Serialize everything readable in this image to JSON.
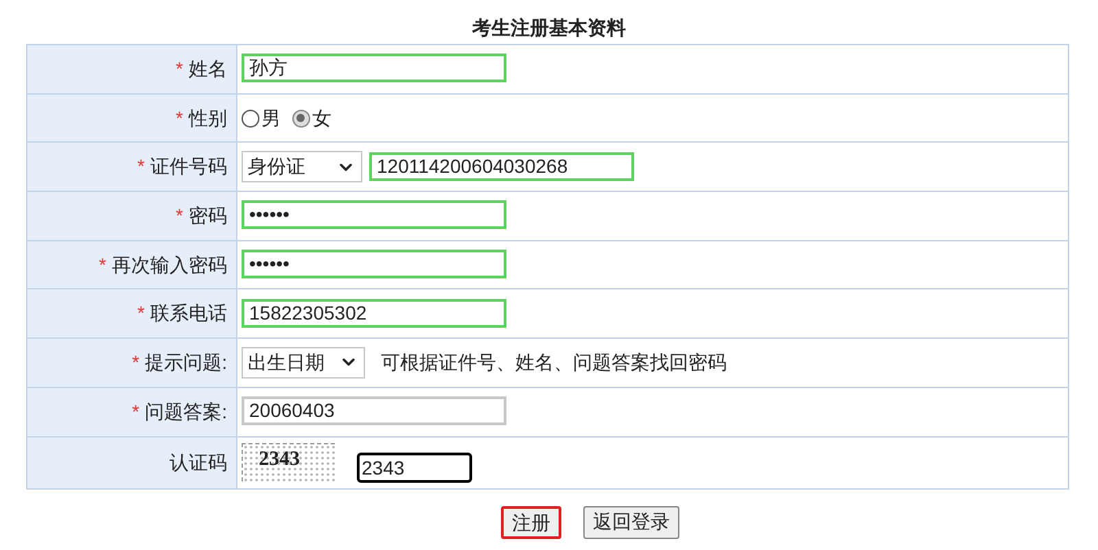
{
  "title": "考生注册基本资料",
  "rows": [
    {
      "kind": "text",
      "label": "姓名",
      "required_mark": "*",
      "value": "孙方",
      "valid": true
    },
    {
      "kind": "radio",
      "label": "性别",
      "required_mark": "*",
      "options": [
        {
          "label": "男",
          "selected": false
        },
        {
          "label": "女",
          "selected": true
        }
      ]
    },
    {
      "kind": "id",
      "label": "证件号码",
      "required_mark": "*",
      "select": "身份证",
      "value": "120114200604030268",
      "valid": true
    },
    {
      "kind": "text",
      "label": "密码",
      "required_mark": "*",
      "value": "••••••",
      "valid": true
    },
    {
      "kind": "text",
      "label": "再次输入密码",
      "required_mark": "*",
      "value": "••••••",
      "valid": true
    },
    {
      "kind": "text",
      "label": "联系电话",
      "required_mark": "*",
      "value": "15822305302",
      "valid": true
    },
    {
      "kind": "select",
      "label": "提示问题:",
      "required_mark": "*",
      "select": "出生日期",
      "hint": "可根据证件号、姓名、问题答案找回密码"
    },
    {
      "kind": "text",
      "label": "问题答案:",
      "required_mark": "*",
      "value": "20060403",
      "valid": false
    },
    {
      "kind": "captcha",
      "label": "认证码",
      "captcha_text": "2343",
      "value": "2343"
    }
  ],
  "buttons": [
    {
      "label": "注册",
      "focused": true
    },
    {
      "label": "返回登录",
      "focused": false
    }
  ]
}
